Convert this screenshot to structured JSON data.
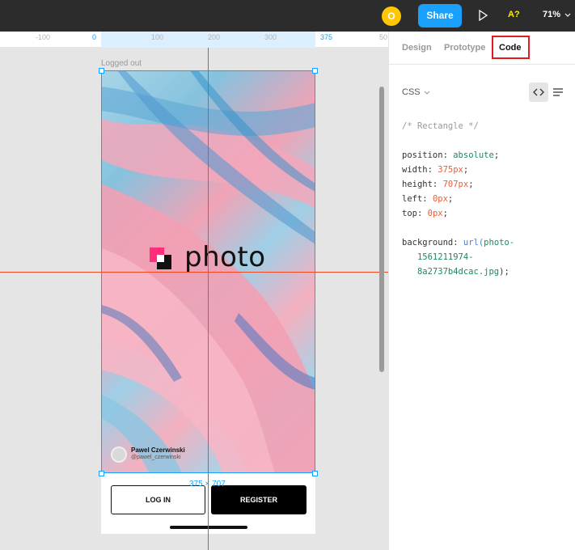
{
  "topbar": {
    "avatar_letter": "O",
    "share_label": "Share",
    "a11y_label": "A?",
    "zoom_label": "71%"
  },
  "ruler": {
    "ticks": [
      "-100",
      "0",
      "100",
      "200",
      "300",
      "375",
      "50"
    ]
  },
  "canvas": {
    "frame_label": "Logged out",
    "size_tag": "375 × 707",
    "photo": {
      "logo_text": "photo",
      "credit_name": "Pawel Czerwinski",
      "credit_handle": "@pawel_czerwinski"
    },
    "login_label": "LOG IN",
    "register_label": "REGISTER"
  },
  "panel": {
    "tabs": [
      "Design",
      "Prototype",
      "Code"
    ],
    "active_tab": "Code",
    "language": "CSS",
    "code": {
      "comment": "/* Rectangle */",
      "position_key": "position:",
      "position_val": "absolute",
      "width_key": "width:",
      "width_val": "375px",
      "height_key": "height:",
      "height_val": "707px",
      "left_key": "left:",
      "left_val": "0px",
      "top_key": "top:",
      "top_val": "0px",
      "bg_key": "background:",
      "bg_fn": "url(",
      "bg_url_1": "photo-",
      "bg_url_2": "1561211974-",
      "bg_url_3": "8a2737b4dcac.jpg",
      "bg_end": ");"
    }
  },
  "colors": {
    "accent": "#18a0fb",
    "guide": "#f24822",
    "highlight": "#e01b24",
    "logo_pink": "#ff2d7a"
  }
}
